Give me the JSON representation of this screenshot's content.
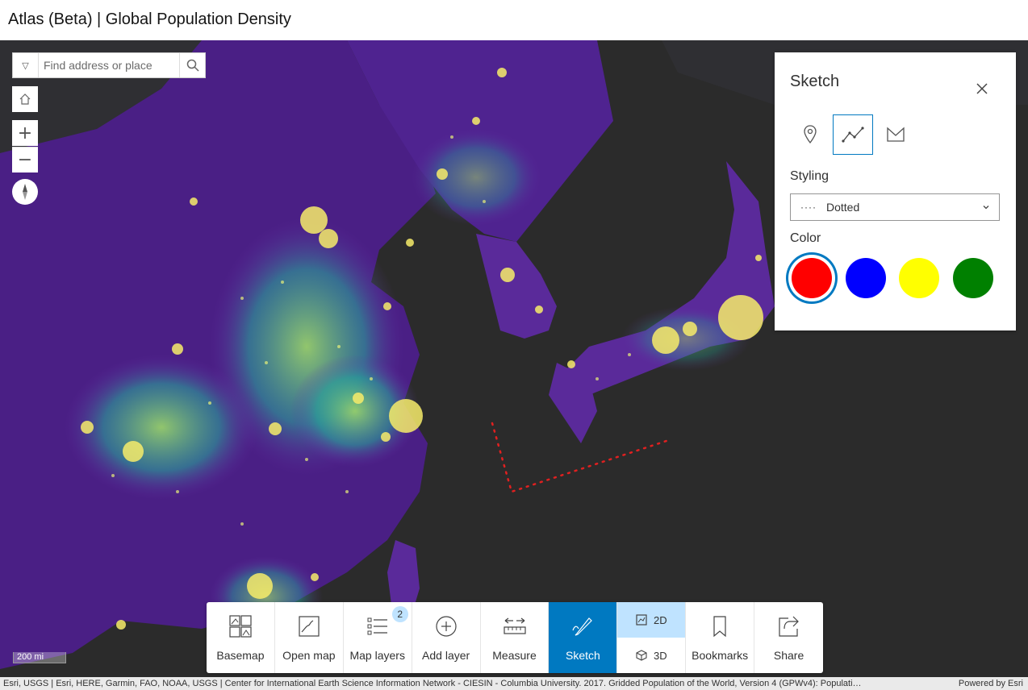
{
  "app": {
    "title": "Atlas (Beta) | Global Population Density"
  },
  "search": {
    "placeholder": "Find address or place"
  },
  "sketch_panel": {
    "title": "Sketch",
    "tools": [
      "point-tool",
      "polyline-tool",
      "polygon-tool"
    ],
    "active_tool": "polyline-tool",
    "styling_label": "Styling",
    "styling_value": "Dotted",
    "styling_dots": "····",
    "color_label": "Color",
    "colors": [
      "#ff0000",
      "#0000ff",
      "#ffff00",
      "#008000"
    ],
    "selected_color": "#ff0000"
  },
  "toolbar": {
    "basemap": "Basemap",
    "open_map": "Open map",
    "map_layers": "Map layers",
    "map_layers_badge": "2",
    "add_layer": "Add layer",
    "measure": "Measure",
    "sketch": "Sketch",
    "view_2d": "2D",
    "view_3d": "3D",
    "active_view": "2D",
    "bookmarks": "Bookmarks",
    "share": "Share"
  },
  "map": {
    "scale": "200 mi"
  },
  "footer": {
    "attribution": "Esri, USGS | Esri, HERE, Garmin, FAO, NOAA, USGS | Center for International Earth Science Information Network - CIESIN - Columbia University. 2017. Gridded Population of the World, Version 4 (GPWv4): Populati…",
    "powered_by": "Powered by Esri"
  },
  "colors": {
    "accent": "#0079c1",
    "accent_light": "#bfe3ff",
    "ocean": "#2b2b2b",
    "land_low": "#3c1a6b",
    "land_mid": "#6a2ea8",
    "density_mid": "#2aa59a",
    "density_high": "#f7ec6a"
  }
}
